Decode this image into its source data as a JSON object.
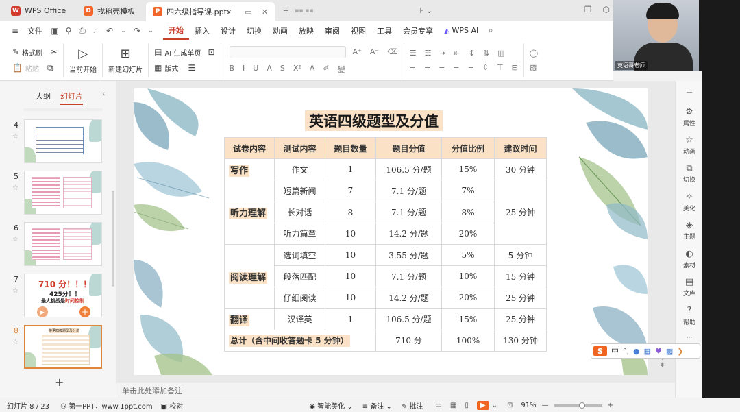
{
  "tabs": [
    {
      "label": "WPS Office",
      "color": "#d13b2b",
      "logo": "W"
    },
    {
      "label": "找稻壳模板",
      "color": "#f0662a",
      "logo": "D"
    },
    {
      "label": "四六级指导课.pptx",
      "color": "#f0662a",
      "logo": "P"
    }
  ],
  "menu": {
    "file": "文件",
    "items": [
      "开始",
      "插入",
      "设计",
      "切换",
      "动画",
      "放映",
      "审阅",
      "视图",
      "工具",
      "会员专享"
    ],
    "ai": "WPS AI",
    "active": "开始"
  },
  "ribbon": {
    "format_painter": "格式刷",
    "paste": "粘贴",
    "play_from_current": "当前开始",
    "new_slide": "新建幻灯片",
    "ai_single": "AI 生成单页",
    "layout": "版式"
  },
  "video": {
    "name": "英语哥老师"
  },
  "left_panel": {
    "tab_outline": "大纲",
    "tab_slides": "幻灯片",
    "slides": [
      {
        "num": "4"
      },
      {
        "num": "5"
      },
      {
        "num": "6"
      },
      {
        "num": "7",
        "line1": "710 分！！！",
        "line2": "425分！！",
        "line3a": "最大挑战是",
        "line3b": "时间控制"
      },
      {
        "num": "8",
        "mini_title": "英语四级题型及分值"
      }
    ]
  },
  "slide": {
    "title": "英语四级题型及分值",
    "headers": [
      "试卷内容",
      "测试内容",
      "题目数量",
      "题目分值",
      "分值比例",
      "建议时间"
    ],
    "rows": [
      {
        "cat": "写作",
        "item": "作文",
        "count": "1",
        "score": "106.5 分/题",
        "ratio": "15%",
        "time": "30 分钟"
      },
      {
        "cat": "听力理解",
        "item": "短篇新闻",
        "count": "7",
        "score": "7.1 分/题",
        "ratio": "7%",
        "time": "25 分钟"
      },
      {
        "item": "长对话",
        "count": "8",
        "score": "7.1 分/题",
        "ratio": "8%"
      },
      {
        "item": "听力篇章",
        "count": "10",
        "score": "14.2 分/题",
        "ratio": "20%"
      },
      {
        "cat": "阅读理解",
        "item": "选词填空",
        "count": "10",
        "score": "3.55 分/题",
        "ratio": "5%",
        "time": "5 分钟"
      },
      {
        "item": "段落匹配",
        "count": "10",
        "score": "7.1 分/题",
        "ratio": "10%",
        "time": "15 分钟"
      },
      {
        "item": "仔细阅读",
        "count": "10",
        "score": "14.2 分/题",
        "ratio": "20%",
        "time": "25 分钟"
      },
      {
        "cat": "翻译",
        "item": "汉译英",
        "count": "1",
        "score": "106.5 分/题",
        "ratio": "15%",
        "time": "25 分钟"
      }
    ],
    "total": {
      "label": "总计（含中间收答题卡 5 分钟）",
      "score": "710 分",
      "ratio": "100%",
      "time": "130 分钟"
    }
  },
  "notes_placeholder": "单击此处添加备注",
  "right_sidebar": [
    "属性",
    "动画",
    "切换",
    "美化",
    "主题",
    "素材",
    "文库",
    "帮助"
  ],
  "ime": {
    "lang": "中"
  },
  "status": {
    "slide_count": "幻灯片 8 / 23",
    "theme": "第一PPT，www.1ppt.com",
    "proof": "校对",
    "beautify": "智能美化",
    "notes": "备注",
    "comments": "批注",
    "zoom": "91%"
  }
}
